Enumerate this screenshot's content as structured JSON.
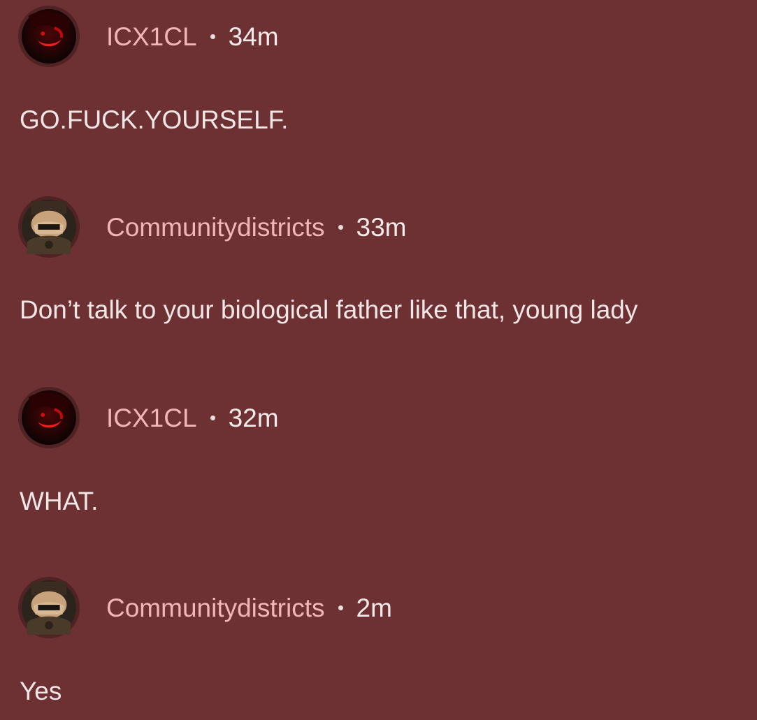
{
  "thread": {
    "comments": [
      {
        "username": "ICX1CL",
        "time": "34m",
        "text": "GO.FUCK.YOURSELF.",
        "avatar_icon": "red-smile-avatar-icon"
      },
      {
        "username": "Communitydistricts",
        "time": "33m",
        "text": "Don’t talk to your biological father like that, young lady",
        "avatar_icon": "masked-figure-avatar-icon"
      },
      {
        "username": "ICX1CL",
        "time": "32m",
        "text": "WHAT.",
        "avatar_icon": "red-smile-avatar-icon"
      },
      {
        "username": "Communitydistricts",
        "time": "2m",
        "text": "Yes",
        "avatar_icon": "masked-figure-avatar-icon"
      }
    ]
  },
  "colors": {
    "background": "#6d3133",
    "username": "#f2b5b8",
    "text": "#f1e7e7"
  }
}
